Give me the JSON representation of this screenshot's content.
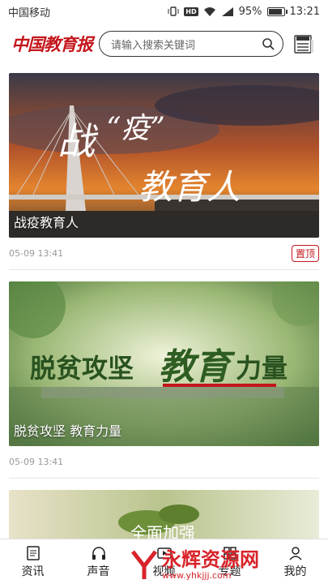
{
  "status": {
    "carrier": "中国移动",
    "hd": "HD",
    "battery_percent": "95%",
    "battery_level": 0.95,
    "time": "13:21"
  },
  "header": {
    "logo": "中国教育报",
    "search_placeholder": "请输入搜索关键词"
  },
  "feed": [
    {
      "caption": "战疫教育人",
      "art_title": "战“疫” 教育人",
      "date": "05-09 13:41",
      "pin": "置顶"
    },
    {
      "caption": "脱贫攻坚 教育力量",
      "art_title_left": "脱贫攻坚",
      "art_title_right": "教育力量",
      "date": "05-09 13:41"
    },
    {
      "caption": "",
      "art_title": "全面加强"
    }
  ],
  "nav": [
    {
      "label": "资讯",
      "icon": "news-icon"
    },
    {
      "label": "声音",
      "icon": "headphones-icon"
    },
    {
      "label": "视频",
      "icon": "video-icon"
    },
    {
      "label": "专题",
      "icon": "topic-icon"
    },
    {
      "label": "我的",
      "icon": "profile-icon"
    }
  ],
  "watermark": {
    "text": "永辉资源网",
    "url": "www.yhkjjj.com"
  }
}
